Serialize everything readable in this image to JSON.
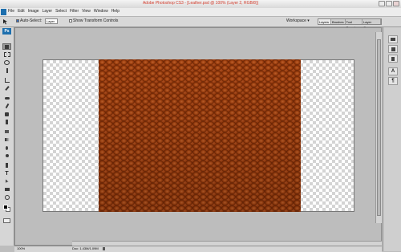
{
  "window": {
    "title": "Adobe Photoshop CS3 - [Leather.psd @ 100% (Layer 2, RGB/8)]"
  },
  "menu": {
    "items": [
      "File",
      "Edit",
      "Image",
      "Layer",
      "Select",
      "Filter",
      "View",
      "Window",
      "Help"
    ]
  },
  "options": {
    "auto_select_label": "Auto-Select:",
    "auto_select_value": "Layer",
    "transform_label": "Show Transform Controls",
    "workspace_label": "Workspace ▾",
    "panel_tabs": [
      "Layers ×",
      "Brushes",
      "Tool Presets",
      "Layer Comps"
    ]
  },
  "toolbox": {
    "badge": "Ps"
  },
  "status": {
    "zoom": "100%",
    "doc": "Doc: 1.43M/1.09M"
  },
  "colors": {
    "accent": "#1d6fae",
    "title_text": "#d23a2a",
    "leather": "#a6420f"
  }
}
